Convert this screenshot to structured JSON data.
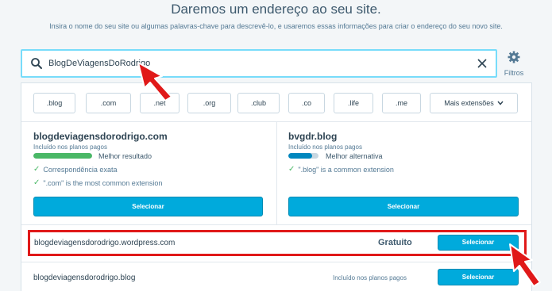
{
  "header": {
    "title": "Daremos um endereço ao seu site.",
    "subtitle": "Insira o nome do seu site ou algumas palavras-chave para descrevê-lo, e usaremos essas informações para criar o endereço do seu novo site."
  },
  "search": {
    "value": "BlogDeViagensDoRodrigo",
    "filters_label": "Filtros"
  },
  "extensions": [
    ".blog",
    ".com",
    ".net",
    ".org",
    ".club",
    ".co",
    ".life",
    ".me"
  ],
  "more_extensions_label": "Mais extensões",
  "cards": [
    {
      "domain": "blogdeviagensdorodrigo.com",
      "note": "Incluído nos planos pagos",
      "badge": "Melhor resultado",
      "progress": 1.0,
      "bar_color": "#4ab866",
      "reasons": [
        "Correspondência exata",
        "\".com\" is the most common extension"
      ],
      "button": "Selecionar"
    },
    {
      "domain": "bvgdr.blog",
      "note": "Incluído nos planos pagos",
      "badge": "Melhor alternativa",
      "progress": 0.8,
      "bar_color": "#0087be",
      "reasons": [
        "\".blog\" is a common extension"
      ],
      "button": "Selecionar"
    }
  ],
  "rows": [
    {
      "domain": "blogdeviagensdorodrigo.wordpress.com",
      "price": "Gratuito",
      "button": "Selecionar"
    },
    {
      "domain": "blogdeviagensdorodrigo.blog",
      "price": "Incluído nos planos pagos",
      "button": "Selecionar"
    }
  ],
  "colors": {
    "accent": "#00aadc",
    "highlight": "#e01919",
    "focus": "#78dcfa"
  }
}
